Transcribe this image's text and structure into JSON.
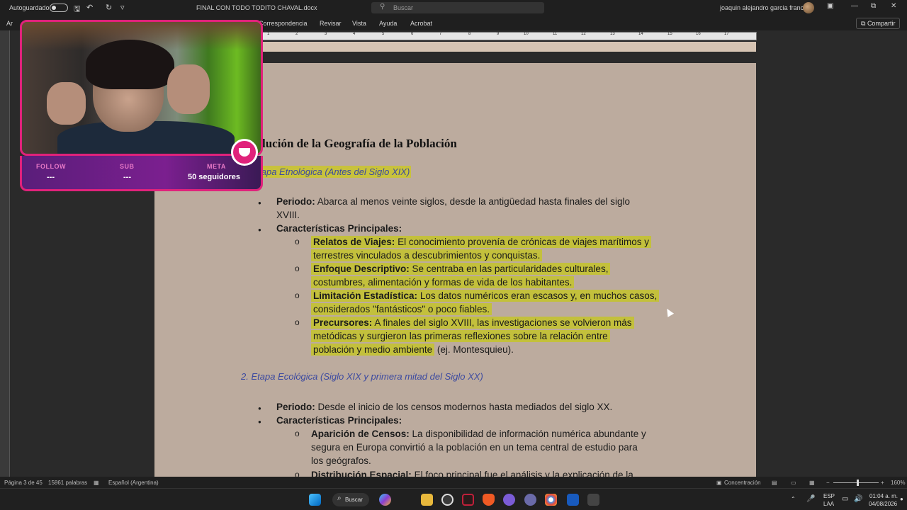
{
  "window": {
    "autosave_label": "Autoguardado",
    "doc_title": "FINAL CON TODO TODITO CHAVAL.docx",
    "search_placeholder": "Buscar",
    "user_name": "joaquin alejandro garcia franco"
  },
  "ribbon": {
    "tabs": [
      "Ar",
      "Correspondencia",
      "Revisar",
      "Vista",
      "Ayuda",
      "Acrobat"
    ],
    "share_label": "Compartir"
  },
  "ruler": {
    "numbers": [
      "1",
      "2",
      "3",
      "4",
      "5",
      "6",
      "7",
      "8",
      "9",
      "10",
      "11",
      "12",
      "13",
      "14",
      "15",
      "16",
      "17"
    ]
  },
  "document": {
    "heading": "lución de la Geografía de la Población",
    "section1_title": "1. Etapa Etnológica (Antes del Siglo XIX)",
    "s1_periodo_label": "Periodo:",
    "s1_periodo_text": "Abarca al menos veinte siglos, desde la antigüedad hasta finales del siglo",
    "s1_periodo_text2": "XVIII.",
    "s1_caract_label": "Características Principales:",
    "relatos_label": "Relatos de Viajes:",
    "relatos_text1": "El conocimiento provenía de crónicas de viajes marítimos y",
    "relatos_text2": "terrestres vinculados a descubrimientos y conquistas.",
    "enfoque_label": "Enfoque Descriptivo:",
    "enfoque_text1": "Se centraba en las particularidades culturales,",
    "enfoque_text2": "costumbres, alimentación y formas de vida de los habitantes.",
    "limitacion_label": "Limitación Estadística:",
    "limitacion_text1": "Los datos numéricos eran escasos y, en muchos casos,",
    "limitacion_text2": "considerados \"fantásticos\" o poco fiables.",
    "precursores_label": "Precursores:",
    "precursores_text1": "A finales del siglo XVIII, las investigaciones se volvieron más",
    "precursores_text2": "metódicas y surgieron las primeras reflexiones sobre la relación entre",
    "precursores_text3": "población y medio ambiente",
    "precursores_text3b": "(ej. Montesquieu).",
    "section2_title": "2. Etapa Ecológica (Siglo XIX y primera mitad del Siglo XX)",
    "s2_periodo_label": "Periodo:",
    "s2_periodo_text": "Desde el inicio de los censos modernos hasta mediados del siglo XX.",
    "s2_caract_label": "Características Principales:",
    "censos_label": "Aparición de Censos:",
    "censos_text1": "La disponibilidad de información numérica abundante y",
    "censos_text2": "segura en Europa convirtió a la población en un tema central de estudio para",
    "censos_text3": "los geógrafos.",
    "distrib_label": "Distribución Espacial:",
    "distrib_text1": "El foco principal fue el análisis y la explicación de la"
  },
  "overlay": {
    "follow_label": "FOLLOW",
    "follow_value": "---",
    "sub_label": "SUB",
    "sub_value": "---",
    "meta_label": "META",
    "meta_value": "50 seguidores"
  },
  "statusbar": {
    "page": "Página 3 de 45",
    "words": "15861 palabras",
    "language": "Español (Argentina)",
    "focus": "Concentración",
    "zoom": "160%"
  },
  "taskbar": {
    "search_label": "Buscar",
    "lang_top": "ESP",
    "lang_bottom": "LAA",
    "time": "01:04 a. m.",
    "date": "04/08/2026"
  }
}
